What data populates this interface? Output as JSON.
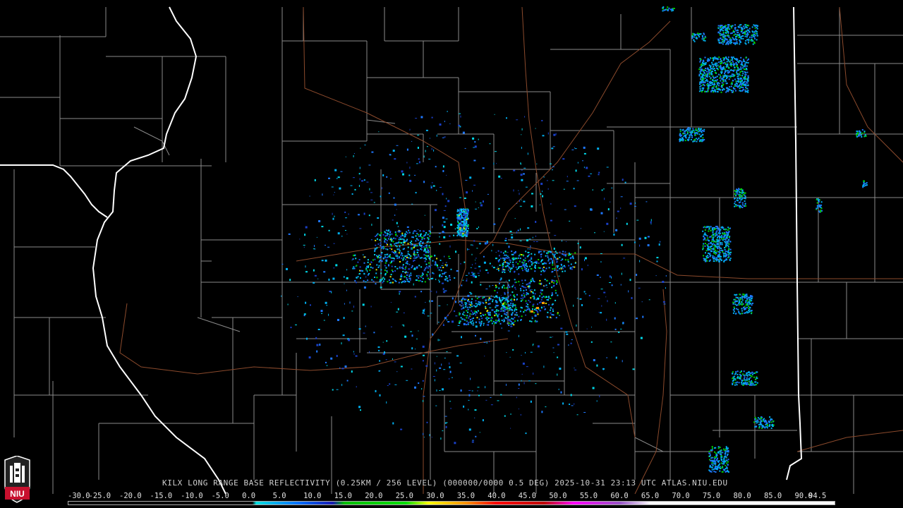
{
  "product_title": "KILX LONG RANGE BASE REFLECTIVITY (0.25KM / 256 LEVEL) (000000/0000 0.5 DEG) 2025-10-31 23:13 UTC  ATLAS.NIU.EDU",
  "colorbar": {
    "labels": [
      "-30.0",
      "-25.0",
      "-20.0",
      "-15.0",
      "-10.0",
      "-5.0",
      "0.0",
      "5.0",
      "10.0",
      "15.0",
      "20.0",
      "25.0",
      "30.0",
      "35.0",
      "40.0",
      "45.0",
      "50.0",
      "55.0",
      "60.0",
      "65.0",
      "70.0",
      "75.0",
      "80.0",
      "85.0",
      "90.0",
      "94.5"
    ],
    "stops": [
      {
        "at": 0.0,
        "color": "#000000"
      },
      {
        "at": 0.24,
        "color": "#000000"
      },
      {
        "at": 0.245,
        "color": "#00e0e0"
      },
      {
        "at": 0.3,
        "color": "#0070ff"
      },
      {
        "at": 0.345,
        "color": "#1a1ab4"
      },
      {
        "at": 0.36,
        "color": "#00c000"
      },
      {
        "at": 0.44,
        "color": "#00e000"
      },
      {
        "at": 0.47,
        "color": "#ffff00"
      },
      {
        "at": 0.52,
        "color": "#ff9000"
      },
      {
        "at": 0.56,
        "color": "#ff0000"
      },
      {
        "at": 0.62,
        "color": "#c00000"
      },
      {
        "at": 0.66,
        "color": "#ff00ff"
      },
      {
        "at": 0.72,
        "color": "#9955c9"
      },
      {
        "at": 0.76,
        "color": "#ffffff"
      },
      {
        "at": 1.0,
        "color": "#ffffff"
      }
    ]
  },
  "logo_text": "NIU",
  "colors": {
    "background": "#000000",
    "county_lines": "#8a8a8a",
    "state_lines": "#ffffff",
    "highways": "#8b4a2c",
    "logo_red": "#c8102e"
  }
}
